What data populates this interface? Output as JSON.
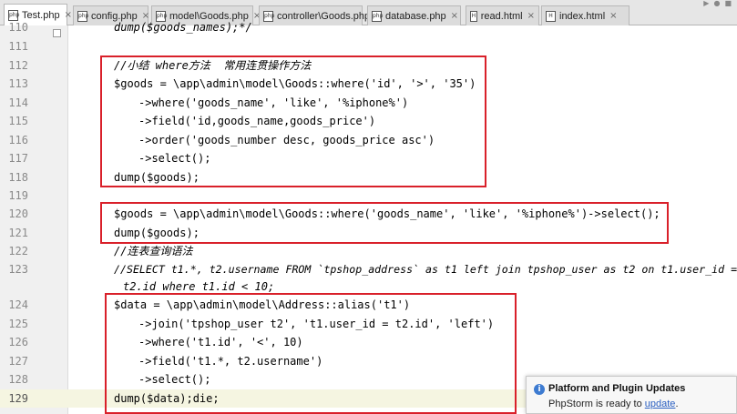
{
  "tabs": [
    {
      "label": "Test.php",
      "icon": "php-file-icon",
      "active": true
    },
    {
      "label": "config.php",
      "icon": "php-file-icon"
    },
    {
      "label": "model\\Goods.php",
      "icon": "php-file-icon"
    },
    {
      "label": "controller\\Goods.php",
      "icon": "php-file-icon"
    },
    {
      "label": "database.php",
      "icon": "php-file-icon"
    },
    {
      "label": "read.html",
      "icon": "html-file-icon"
    },
    {
      "label": "index.html",
      "icon": "html-file-icon"
    }
  ],
  "code": {
    "current_line": "129",
    "lines": [
      {
        "num": "110",
        "text": "dump($goods_names);*/"
      },
      {
        "num": "111",
        "text": ""
      },
      {
        "num": "112",
        "text": "//小结 where方法  常用连贯操作方法"
      },
      {
        "num": "113",
        "text": "$goods = \\app\\admin\\model\\Goods::where('id', '>', '35')"
      },
      {
        "num": "114",
        "text": "->where('goods_name', 'like', '%iphone%')"
      },
      {
        "num": "115",
        "text": "->field('id,goods_name,goods_price')"
      },
      {
        "num": "116",
        "text": "->order('goods_number desc, goods_price asc')"
      },
      {
        "num": "117",
        "text": "->select();"
      },
      {
        "num": "118",
        "text": "dump($goods);"
      },
      {
        "num": "119",
        "text": ""
      },
      {
        "num": "120",
        "text": "$goods = \\app\\admin\\model\\Goods::where('goods_name', 'like', '%iphone%')->select();"
      },
      {
        "num": "121",
        "text": "dump($goods);"
      },
      {
        "num": "122",
        "text": "//连表查询语法"
      },
      {
        "num": "123",
        "text": "//SELECT t1.*, t2.username FROM `tpshop_address` as t1 left join tpshop_user as t2 on t1.user_id ="
      },
      {
        "num": "",
        "text": "t2.id where t1.id < 10;"
      },
      {
        "num": "124",
        "text": "$data = \\app\\admin\\model\\Address::alias('t1')"
      },
      {
        "num": "125",
        "text": "->join('tpshop_user t2', 't1.user_id = t2.id', 'left')"
      },
      {
        "num": "126",
        "text": "->where('t1.id', '<', 10)"
      },
      {
        "num": "127",
        "text": "->field('t1.*, t2.username')"
      },
      {
        "num": "128",
        "text": "->select();"
      },
      {
        "num": "129",
        "text": "dump($data);die;"
      }
    ]
  },
  "notification": {
    "title": "Platform and Plugin Updates",
    "body_prefix": "PhpStorm is ready to ",
    "link": "update",
    "body_suffix": "."
  }
}
